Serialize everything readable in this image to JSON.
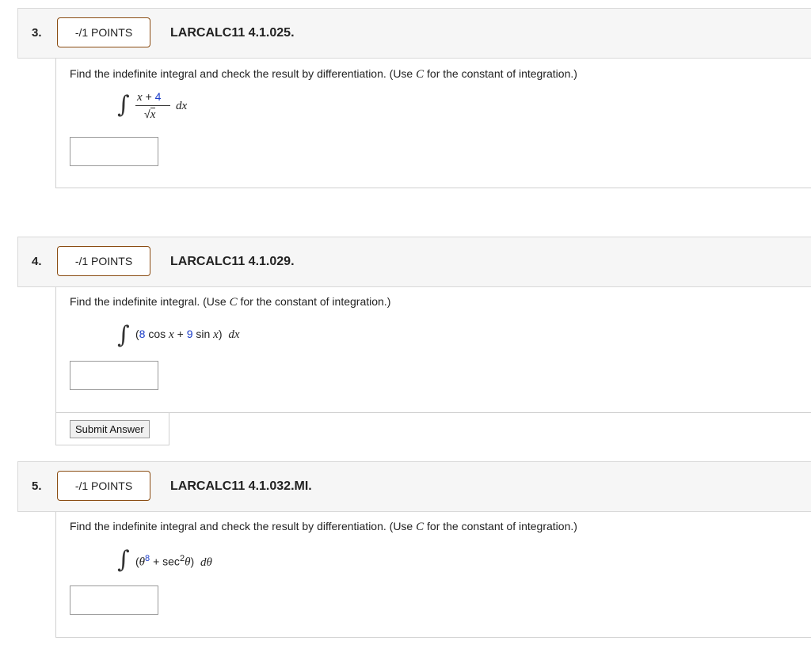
{
  "questions": [
    {
      "number": "3.",
      "points": "-/1 POINTS",
      "code": "LARCALC11 4.1.025.",
      "prompt_before": "Find the indefinite integral and check the result by differentiation. (Use ",
      "prompt_var": "C",
      "prompt_after": " for the constant of integration.)",
      "integral": {
        "numerator_var": "x",
        "numerator_op": "+",
        "numerator_const": "4",
        "denominator": "x",
        "differential": "dx"
      },
      "answer_value": ""
    },
    {
      "number": "4.",
      "points": "-/1 POINTS",
      "code": "LARCALC11 4.1.029.",
      "prompt_before": "Find the indefinite integral. (Use ",
      "prompt_var": "C",
      "prompt_after": " for the constant of integration.)",
      "integral": {
        "open": "(",
        "coef1": "8",
        "term1": "cos",
        "var1": "x",
        "op": "+",
        "coef2": "9",
        "term2": "sin",
        "var2": "x",
        "close": ")",
        "differential": "dx"
      },
      "answer_value": "",
      "submit_label": "Submit Answer"
    },
    {
      "number": "5.",
      "points": "-/1 POINTS",
      "code": "LARCALC11 4.1.032.MI.",
      "prompt_before": "Find the indefinite integral and check the result by differentiation. (Use ",
      "prompt_var": "C",
      "prompt_after": " for the constant of integration.)",
      "integral": {
        "open": "(",
        "base": "θ",
        "exponent": "8",
        "op": "+",
        "func": "sec",
        "func_exp": "2",
        "func_arg": "θ",
        "close": ")",
        "differential": "dθ"
      },
      "answer_value": ""
    }
  ]
}
